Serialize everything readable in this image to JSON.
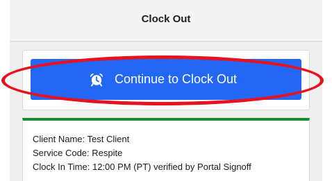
{
  "header": {
    "title": "Clock Out"
  },
  "action": {
    "continue_label": "Continue to Clock Out",
    "icon": "alarm-clock-icon",
    "button_color": "#2367f5",
    "highlight_color": "#e8121f"
  },
  "visit_info": {
    "accent_color": "#1e8a2e",
    "client_line": "Client Name: Test Client",
    "service_line": "Service Code: Respite",
    "clock_in_line": "Clock In Time: 12:00 PM (PT) verified by Portal Signoff"
  }
}
